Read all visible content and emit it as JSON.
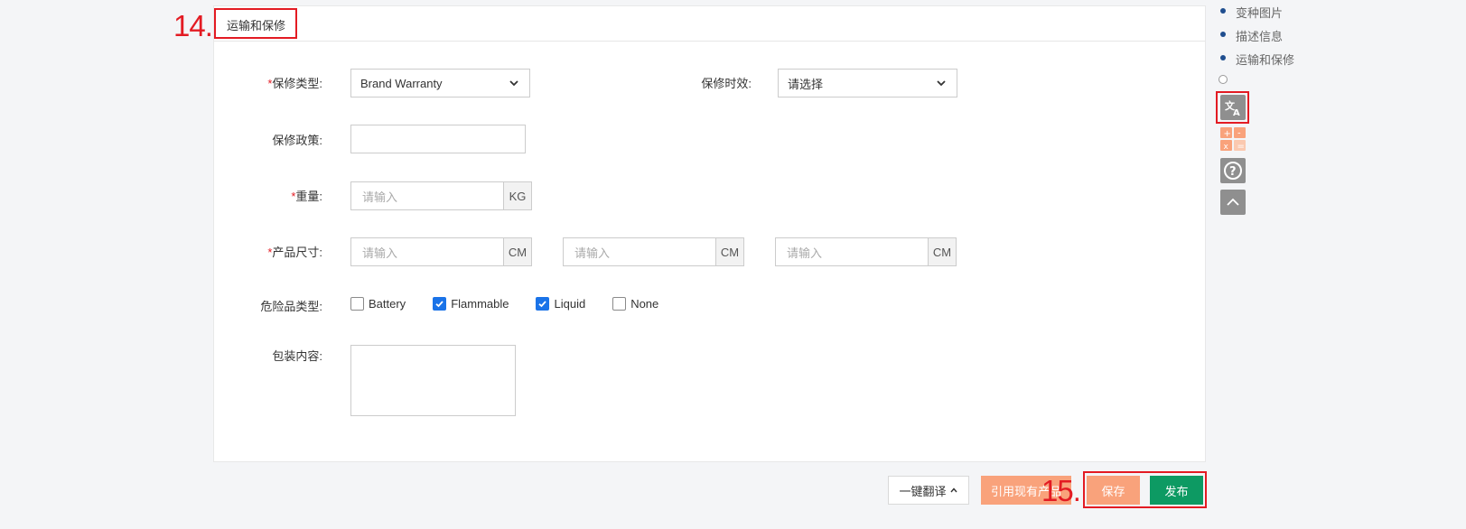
{
  "section": {
    "title": "运输和保修"
  },
  "annotations": {
    "step14": "14.",
    "step15": "15."
  },
  "form": {
    "warranty_type": {
      "required_mark": "*",
      "label": "保修类型:",
      "value": "Brand Warranty"
    },
    "warranty_period": {
      "label": "保修时效:",
      "value": "请选择"
    },
    "warranty_policy": {
      "label": "保修政策:",
      "value": ""
    },
    "weight": {
      "required_mark": "*",
      "label": "重量:",
      "placeholder": "请输入",
      "unit": "KG"
    },
    "dimensions": {
      "required_mark": "*",
      "label": "产品尺寸:",
      "fields": [
        {
          "placeholder": "请输入",
          "unit": "CM"
        },
        {
          "placeholder": "请输入",
          "unit": "CM"
        },
        {
          "placeholder": "请输入",
          "unit": "CM"
        }
      ]
    },
    "dangerous_goods": {
      "label": "危险品类型:",
      "options": [
        {
          "label": "Battery",
          "checked": false
        },
        {
          "label": "Flammable",
          "checked": true
        },
        {
          "label": "Liquid",
          "checked": true
        },
        {
          "label": "None",
          "checked": false
        }
      ]
    },
    "package_contents": {
      "label": "包装内容:",
      "value": ""
    }
  },
  "footer": {
    "translate_label": "一键翻译",
    "cite_label": "引用现有产品",
    "save_label": "保存",
    "publish_label": "发布"
  },
  "side_nav": {
    "items": [
      {
        "label": "变种图片"
      },
      {
        "label": "描述信息"
      },
      {
        "label": "运输和保修"
      }
    ]
  },
  "tools": {
    "translate_icon": "translate-icon",
    "calculator_icon": "calculator-icon",
    "help_icon": "help-icon",
    "top_icon": "chevron-up-icon"
  },
  "colors": {
    "annotation_red": "#e31b23",
    "save_orange": "#f9a27b",
    "publish_green": "#0d9a63",
    "nav_dot_blue": "#1f4e8f",
    "checkbox_blue": "#1a73e8"
  }
}
